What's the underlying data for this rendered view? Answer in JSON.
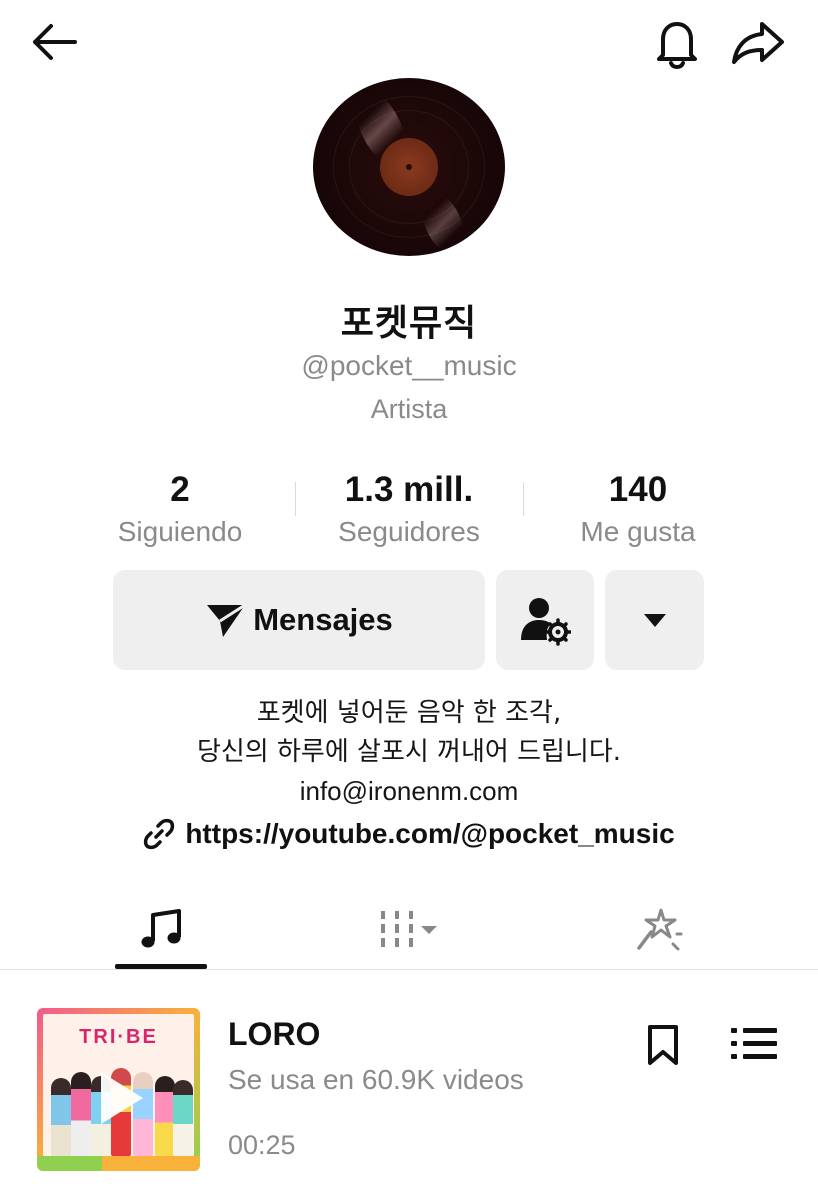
{
  "profile": {
    "name": "포켓뮤직",
    "handle": "@pocket__music",
    "role": "Artista"
  },
  "stats": [
    {
      "value": "2",
      "label": "Siguiendo"
    },
    {
      "value": "1.3 mill.",
      "label": "Seguidores"
    },
    {
      "value": "140",
      "label": "Me gusta"
    }
  ],
  "actions": {
    "message_label": "Mensajes"
  },
  "bio": {
    "line1": "포켓에 넣어둔 음악 한 조각,",
    "line2": "당신의 하루에 살포시 꺼내어 드립니다.",
    "line3": "info@ironenm.com"
  },
  "link": {
    "text": "https://youtube.com/@pocket_music"
  },
  "tabs": [
    {
      "icon": "music-note-icon",
      "active": true
    },
    {
      "icon": "collections-icon",
      "active": false
    },
    {
      "icon": "effects-icon",
      "active": false
    }
  ],
  "track": {
    "title": "LORO",
    "usage": "Se usa en 60.9K videos",
    "duration": "00:25",
    "cover_logo": "TRI·BE"
  },
  "colors": {
    "text": "#111111",
    "muted": "#8a8a8a",
    "button_bg": "#efefef"
  }
}
